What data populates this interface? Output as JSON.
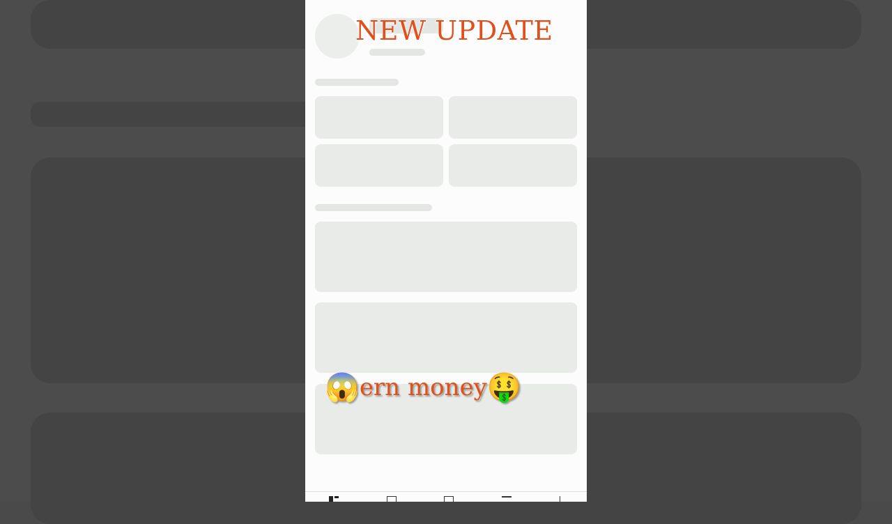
{
  "overlay": {
    "headline": "NEW UPDATE",
    "caption": "ern money",
    "caption_emoji_left": "😱",
    "caption_emoji_right": "🤑"
  },
  "colors": {
    "accent": "#e0501c",
    "skeleton": "#e9ebe8",
    "backdrop": "#4c4c4c"
  },
  "bottom_nav": {
    "icons": [
      "dashboard-icon",
      "video-icon",
      "analytics-icon",
      "content-icon",
      "earn-icon"
    ]
  }
}
